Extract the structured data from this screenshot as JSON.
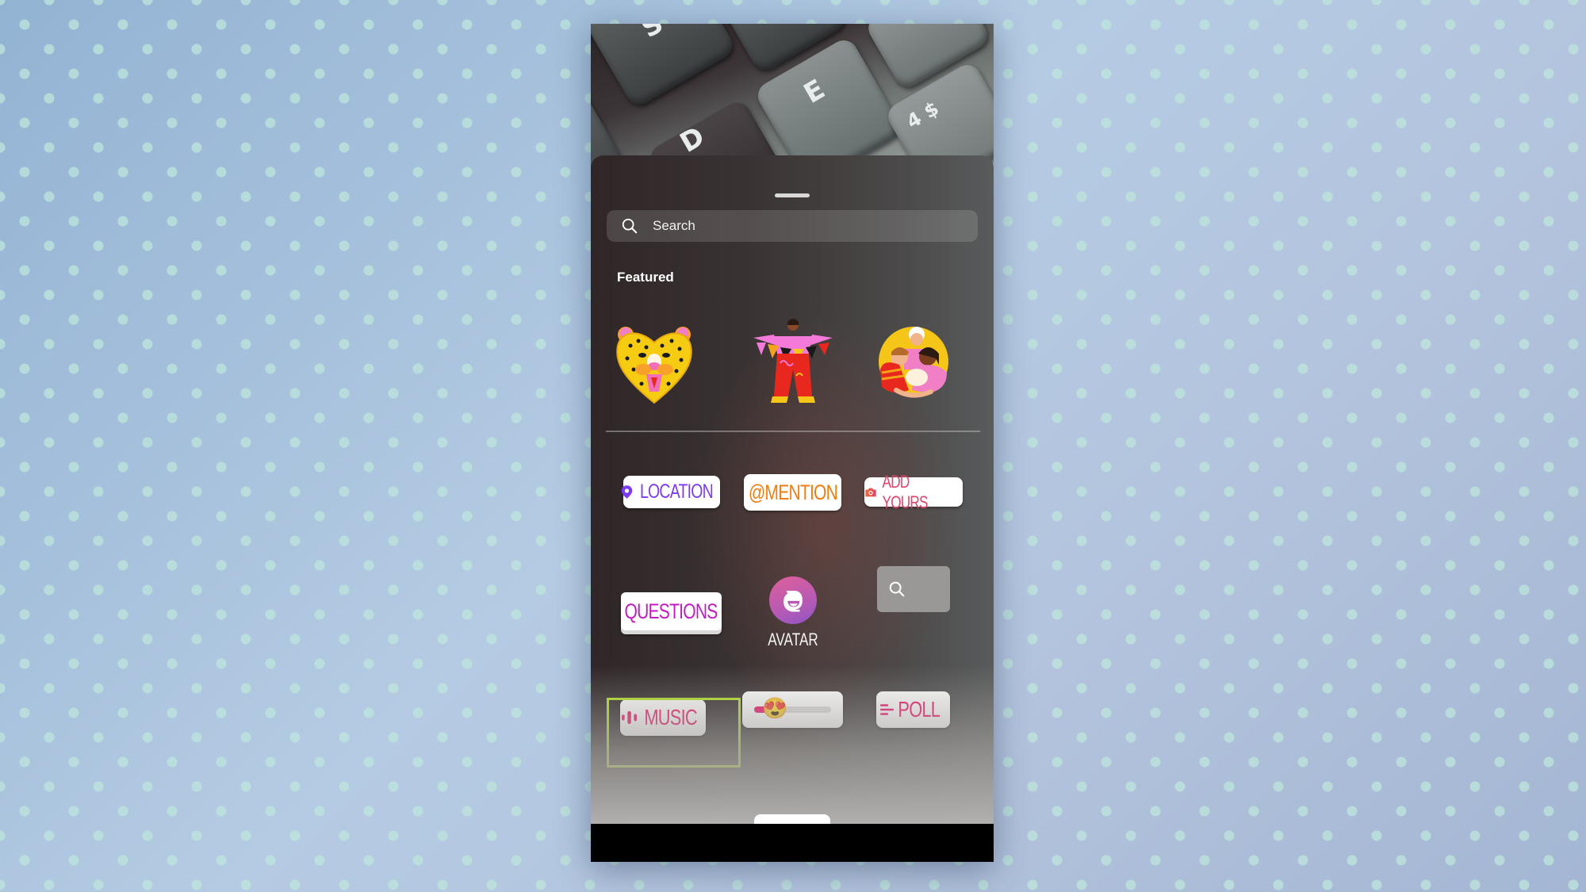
{
  "sheet": {
    "search_placeholder": "Search",
    "featured_label": "Featured",
    "featured_stickers": [
      {
        "name": "leopard-heart-sticker"
      },
      {
        "name": "dancer-bunting-sticker"
      },
      {
        "name": "family-hug-sticker"
      }
    ],
    "stickers": {
      "location": {
        "label": "LOCATION",
        "color": "#7b3cf0"
      },
      "mention": {
        "label": "@MENTION",
        "color": "#f07d10"
      },
      "add_yours": {
        "label": "ADD YOURS",
        "color": "#e0436a"
      },
      "questions": {
        "label": "QUESTIONS",
        "color": "#c21bc2"
      },
      "avatar": {
        "label": "AVATAR"
      },
      "gif_search": {
        "label": ""
      },
      "music": {
        "label": "MUSIC",
        "color": "#f0146b"
      },
      "emoji_slider": {
        "emoji": "😍",
        "value": 0.25,
        "color": "#f0146b"
      },
      "poll": {
        "label": "POLL",
        "color": "#f0146b"
      }
    },
    "highlighted_item": "music"
  },
  "colors": {
    "highlight": "#b3e51e",
    "background": "#a9bfd9"
  }
}
